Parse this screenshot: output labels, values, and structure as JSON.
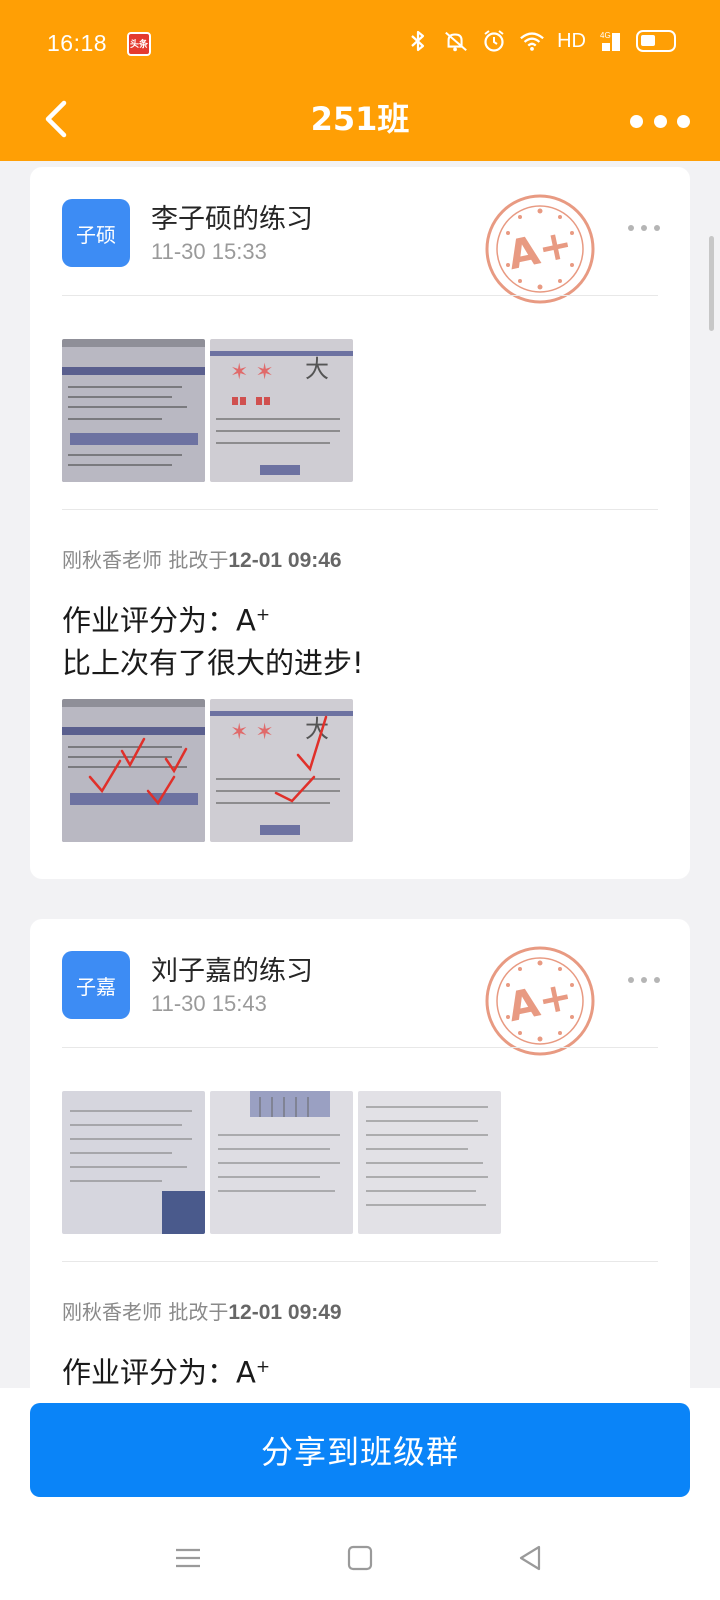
{
  "status_bar": {
    "time": "16:18",
    "app_badge": "头条",
    "network": "HD",
    "icons": [
      "bluetooth-icon",
      "mute-icon",
      "alarm-icon",
      "wifi-icon",
      "signal-4g-icon",
      "battery-icon"
    ]
  },
  "header": {
    "title": "251班",
    "back_icon": "chevron-left-icon",
    "more_icon": "more-dots-icon"
  },
  "posts": [
    {
      "avatar_text": "子硕",
      "name": "李子硕的练习",
      "time": "11-30 15:33",
      "grade": "A+",
      "grader_label": "刚秋香老师 批改于",
      "graded_at": "12-01 09:46",
      "comment_prefix": "作业评分为：A",
      "comment_sup": "+",
      "comment_line2": "比上次有了很大的进步!",
      "submitted_images": 2,
      "corrected_images": 2
    },
    {
      "avatar_text": "子嘉",
      "name": "刘子嘉的练习",
      "time": "11-30 15:43",
      "grade": "A+",
      "grader_label": "刚秋香老师 批改于",
      "graded_at": "12-01 09:49",
      "comment_prefix": "作业评分为：A",
      "comment_sup": "+",
      "submitted_images": 3
    }
  ],
  "share_button": "分享到班级群",
  "nav_bar": [
    "menu-icon",
    "home-square-icon",
    "back-triangle-icon"
  ],
  "colors": {
    "brand_orange": "#ff9f05",
    "avatar_blue": "#3d8cf4",
    "share_blue": "#0a84f8",
    "stamp_red": "#e89a82",
    "correction_red": "#e0302a"
  }
}
